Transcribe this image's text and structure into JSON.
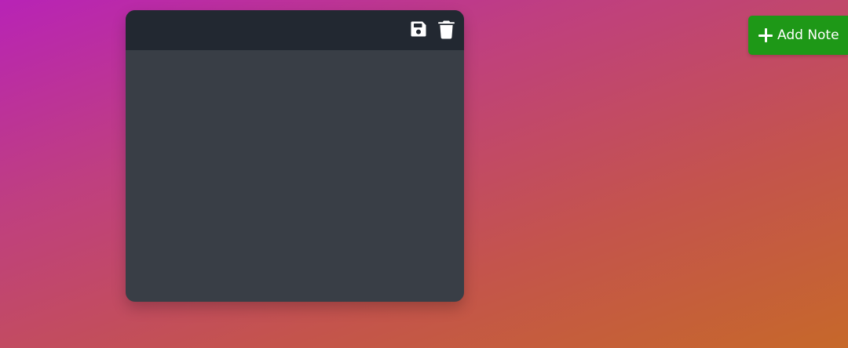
{
  "toolbar": {
    "add_note_label": "Add Note",
    "add_note_icon": "plus-icon"
  },
  "note": {
    "content": "",
    "save_icon": "floppy-disk-icon",
    "delete_icon": "trash-icon"
  },
  "colors": {
    "note_header": "#222831",
    "note_body": "#393e46",
    "add_button": "#1e9817",
    "icon": "#ffffff",
    "gradient_start": "#b823b6",
    "gradient_end": "#c6682a"
  }
}
